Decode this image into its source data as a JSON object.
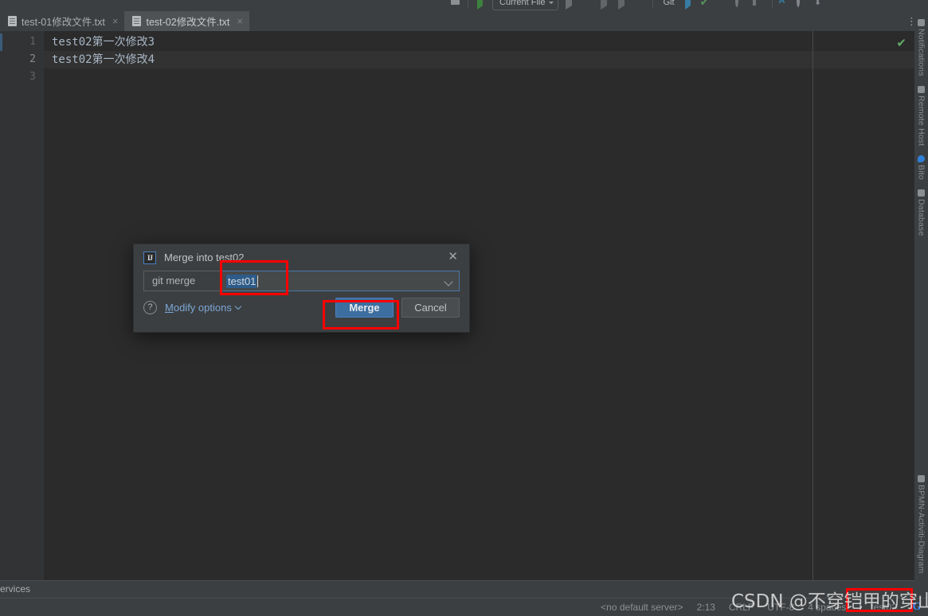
{
  "toolbar": {
    "run_config_label": "Current File",
    "git_label": "Git",
    "icons": [
      "run-config-icon",
      "run-icon",
      "debug-icon",
      "coverage-icon",
      "profiler-icon",
      "stop-icon",
      "git-update-icon",
      "git-commit-icon",
      "git-push-icon",
      "git-history-icon",
      "git-rollback-icon",
      "translate-icon",
      "search-everywhere-icon",
      "download-icon",
      "bito-icon"
    ]
  },
  "tabs": [
    {
      "label": "test-01修改文件.txt",
      "active": false,
      "icon": "text-file-icon",
      "close": "×"
    },
    {
      "label": "test-02修改文件.txt",
      "active": true,
      "icon": "text-file-icon",
      "close": "×"
    }
  ],
  "tabbar_overflow": "⋮",
  "editor": {
    "lines": [
      {
        "number": "1",
        "text": "test02第一次修改3",
        "current": false
      },
      {
        "number": "2",
        "text": "test02第一次修改4",
        "current": true
      },
      {
        "number": "3",
        "text": "",
        "current": false
      }
    ],
    "inspection_status": "✔"
  },
  "right_sidebar": {
    "items": [
      {
        "label": "Notifications",
        "icon": "bell-icon"
      },
      {
        "label": "Remote Host",
        "icon": "remote-host-icon"
      },
      {
        "label": "Bito",
        "icon": "bito-icon"
      },
      {
        "label": "Database",
        "icon": "database-icon"
      }
    ],
    "bottom_item": {
      "label": "BPMN-Activiti-Diagram",
      "icon": "diagram-icon"
    }
  },
  "bottom_tool_window": {
    "label": "ervices"
  },
  "status_bar": {
    "server": "<no default server>",
    "caret_position": "2:13",
    "line_separator": "CRLF",
    "encoding": "UTF-8",
    "indent": "4 spaces",
    "branch": "test02",
    "branch_icon": "git-branch-icon",
    "google_icon": "G"
  },
  "dialog": {
    "icon": "intellij-idea-icon",
    "title": "Merge into test02",
    "close_label": "✕",
    "prefix_label": "git merge",
    "input_value": "test01",
    "input_placeholder": "",
    "dropdown_icon": "chevron-down-icon",
    "help_icon": "?",
    "modify_options_label": "Modify options",
    "modify_options_first_letter": "M",
    "modify_options_rest": "odify options",
    "merge_button": "Merge",
    "cancel_button": "Cancel"
  },
  "annotations": {
    "color": "#fe0000",
    "boxes": [
      "merge-input-highlight",
      "merge-button-highlight",
      "branch-widget-highlight"
    ]
  },
  "watermark": {
    "text": "CSDN @不穿铠甲的穿山甲"
  }
}
